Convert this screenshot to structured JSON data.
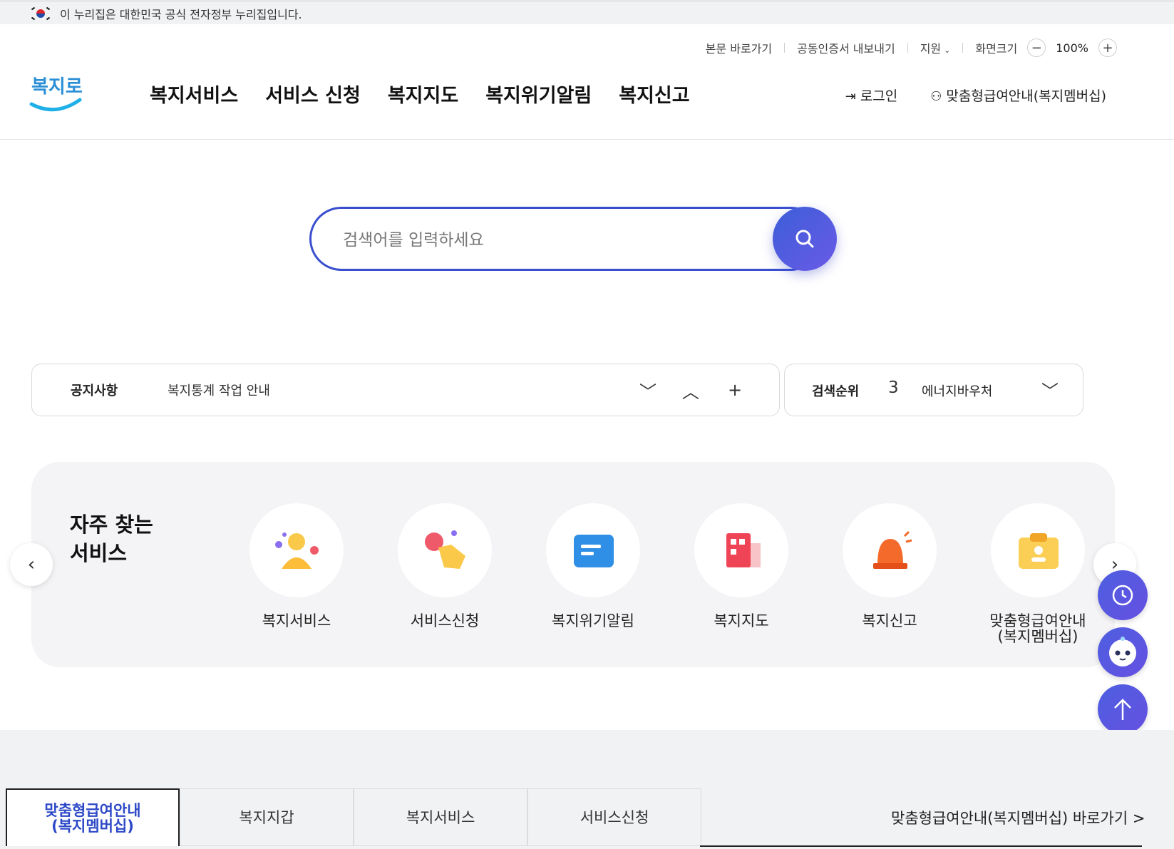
{
  "gov_banner": {
    "text": "이 누리집은 대한민국 공식 전자정부 누리집입니다."
  },
  "util": {
    "skip": "본문 바로가기",
    "cert": "공동인증서 내보내기",
    "support": "지원",
    "screen_size": "화면크기",
    "zoom_minus": "−",
    "zoom_value": "100%",
    "zoom_plus": "+"
  },
  "logo": {
    "text": "복지로"
  },
  "gnb": [
    "복지서비스",
    "서비스 신청",
    "복지지도",
    "복지위기알림",
    "복지신고"
  ],
  "gnb_right": {
    "login": "로그인",
    "member": "맞춤형급여안내(복지멤버십)"
  },
  "search": {
    "placeholder": "검색어를 입력하세요"
  },
  "notice": {
    "label": "공지사항",
    "text": "복지통계 작업 안내"
  },
  "rank": {
    "label": "검색순위",
    "number": "3",
    "text": "에너지바우처"
  },
  "frequent": {
    "title_line1": "자주 찾는",
    "title_line2": "서비스",
    "items": [
      {
        "label": "복지서비스",
        "icon": "person-icon"
      },
      {
        "label": "서비스신청",
        "icon": "hand-tap-icon"
      },
      {
        "label": "복지위기알림",
        "icon": "message-icon"
      },
      {
        "label": "복지지도",
        "icon": "building-icon"
      },
      {
        "label": "복지신고",
        "icon": "siren-icon"
      },
      {
        "label": "맞춤형급여안내",
        "label2": "(복지멤버십)",
        "icon": "membership-card-icon"
      }
    ]
  },
  "tabs": [
    {
      "label": "맞춤형급여안내",
      "label2": "(복지멤버십)"
    },
    {
      "label": "복지지갑"
    },
    {
      "label": "복지서비스"
    },
    {
      "label": "서비스신청"
    }
  ],
  "tab_link": "맞춤형급여안내(복지멤버십) 바로가기 >",
  "colors": {
    "accent": "#3a4fd0",
    "float": "#5757e0"
  }
}
